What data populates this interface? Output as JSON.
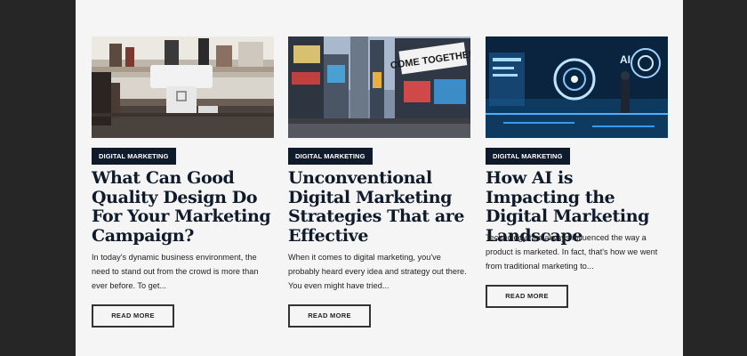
{
  "posts": [
    {
      "category": "DIGITAL MARKETING",
      "title": "What Can Good Quality Design Do For Your Marketing Campaign?",
      "excerpt": "In today's dynamic business environment, the need to stand out from the crowd is more than ever before. To get...",
      "button": "READ MORE",
      "image": "office-pos-terminal-photo"
    },
    {
      "category": "DIGITAL MARKETING",
      "title": "Unconventional Digital Marketing Strategies That are Effective",
      "excerpt": "When it comes to digital marketing, you've probably heard every idea and strategy out there. You even might have tried...",
      "button": "READ MORE",
      "image": "times-square-billboards-photo",
      "image_text": "COME TOGETHER"
    },
    {
      "category": "DIGITAL MARKETING",
      "title": "How AI is Impacting the Digital Marketing Landscape",
      "excerpt": "Technology has always influenced the way a product is marketed. In fact, that's how we went from traditional marketing to...",
      "button": "READ MORE",
      "image": "ai-futuristic-interface-photo",
      "image_text": "AI"
    }
  ],
  "colors": {
    "page_bg": "#f5f5f5",
    "frame_bg": "#262626",
    "badge_bg": "#0f1a2b",
    "title_color": "#0f1a2b"
  }
}
